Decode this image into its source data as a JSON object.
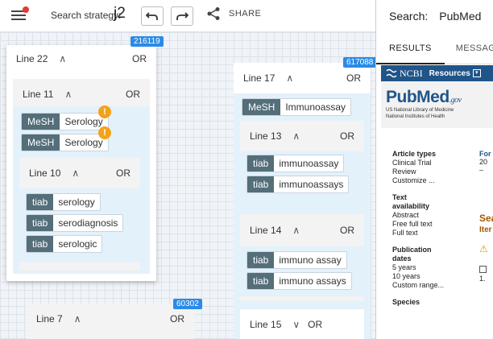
{
  "toolbar": {
    "strategy_label": "Search strategy:",
    "strategy_name": "j2",
    "share_label": "SHARE"
  },
  "canvas": {
    "line22": {
      "title": "Line 22",
      "op": "OR",
      "count": "216119"
    },
    "line11": {
      "title": "Line 11",
      "op": "OR",
      "terms": [
        {
          "tag": "MeSH",
          "text": "Serology",
          "warn": "!"
        },
        {
          "tag": "MeSH",
          "text": "Serology",
          "warn": "!"
        }
      ]
    },
    "line10": {
      "title": "Line 10",
      "op": "OR",
      "terms": [
        {
          "tag": "tiab",
          "text": "serology"
        },
        {
          "tag": "tiab",
          "text": "serodiagnosis"
        },
        {
          "tag": "tiab",
          "text": "serologic"
        }
      ]
    },
    "line17": {
      "title": "Line 17",
      "op": "OR",
      "count": "617088",
      "term": {
        "tag": "MeSH",
        "text": "Immunoassay"
      }
    },
    "line13": {
      "title": "Line 13",
      "op": "OR",
      "terms": [
        {
          "tag": "tiab",
          "text": "immunoassay"
        },
        {
          "tag": "tiab",
          "text": "immunoassays"
        }
      ]
    },
    "line14": {
      "title": "Line 14",
      "op": "OR",
      "terms": [
        {
          "tag": "tiab",
          "text": "immuno assay"
        },
        {
          "tag": "tiab",
          "text": "immuno assays"
        }
      ]
    },
    "line15": {
      "title": "Line 15",
      "op": "OR"
    },
    "line7": {
      "title": "Line 7",
      "op": "OR",
      "count": "60302"
    }
  },
  "panel": {
    "search_label": "Search:",
    "database": "PubMed",
    "tabs": [
      "RESULTS",
      "MESSAGE"
    ],
    "ncbi": "NCBI",
    "resources": "Resources",
    "pubmed_word": "PubMed",
    "pubmed_gov": ".gov",
    "pubmed_sub1": "US National Library of Medicine",
    "pubmed_sub2": "National Institutes of Health",
    "filters": {
      "article_types_h": "Article types",
      "article_types": [
        "Clinical Trial",
        "Review",
        "Customize ..."
      ],
      "text_avail_h": "Text availability",
      "text_avail": [
        "Abstract",
        "Free full text",
        "Full text"
      ],
      "pub_dates_h": "Publication dates",
      "pub_dates": [
        "5 years",
        "10 years",
        "Custom range..."
      ],
      "species_h": "Species"
    },
    "right": {
      "format": "For",
      "page": "20 –",
      "search_h": "Sea",
      "items": "Iter",
      "num": "1."
    }
  }
}
